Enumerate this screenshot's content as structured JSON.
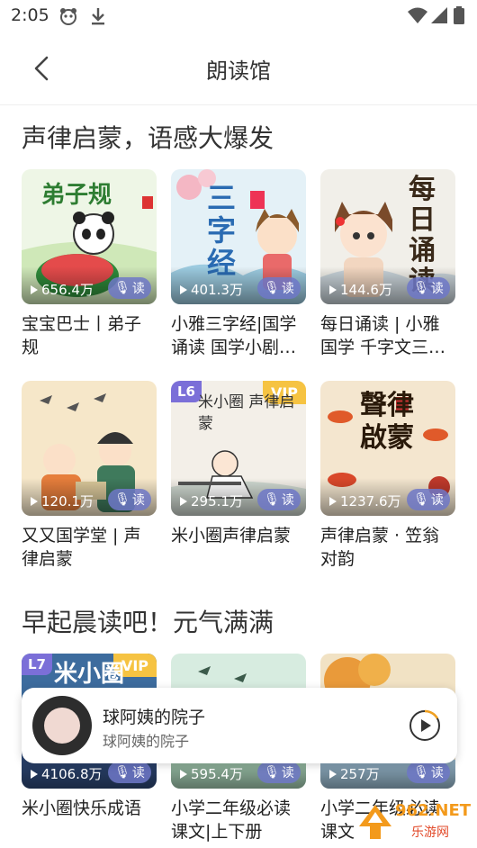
{
  "status_bar": {
    "time": "2:05"
  },
  "header": {
    "title": "朗读馆"
  },
  "sections": [
    {
      "title": "声律启蒙，语感大爆发",
      "items": [
        {
          "title": "宝宝巴士丨弟子规",
          "plays": "656.4万",
          "read_label": "读",
          "cover_text": "弟子规"
        },
        {
          "title": "小雅三字经|国学诵读 国学小剧…",
          "plays": "401.3万",
          "read_label": "读",
          "cover_text": "三字经"
        },
        {
          "title": "每日诵读 | 小雅国学 千字文三…",
          "plays": "144.6万",
          "read_label": "读",
          "cover_text": "每日诵读"
        },
        {
          "title": "又又国学堂 | 声律启蒙",
          "plays": "120.1万",
          "read_label": "读"
        },
        {
          "title": "米小圈声律启蒙",
          "plays": "295.1万",
          "read_label": "读",
          "level": "L6",
          "vip": "VIP",
          "cover_text": "米小圈 声律启蒙"
        },
        {
          "title": "声律启蒙 · 笠翁对韵",
          "plays": "1237.6万",
          "read_label": "读",
          "cover_text": "聲律啟蒙"
        }
      ]
    },
    {
      "title": "早起晨读吧！元气满满",
      "items": [
        {
          "title": "米小圈快乐成语",
          "plays": "4106.8万",
          "read_label": "读",
          "level": "L7",
          "vip": "VIP",
          "cover_text": "米小圈"
        },
        {
          "title": "小学二年级必读课文|上下册",
          "plays": "595.4万",
          "read_label": "读"
        },
        {
          "title": "小学二年级必读课文",
          "plays": "257万",
          "read_label": "读"
        }
      ]
    }
  ],
  "player": {
    "title": "球阿姨的院子",
    "subtitle": "球阿姨的院子"
  },
  "watermark": {
    "text": "962.NET",
    "sub": "乐游网"
  }
}
